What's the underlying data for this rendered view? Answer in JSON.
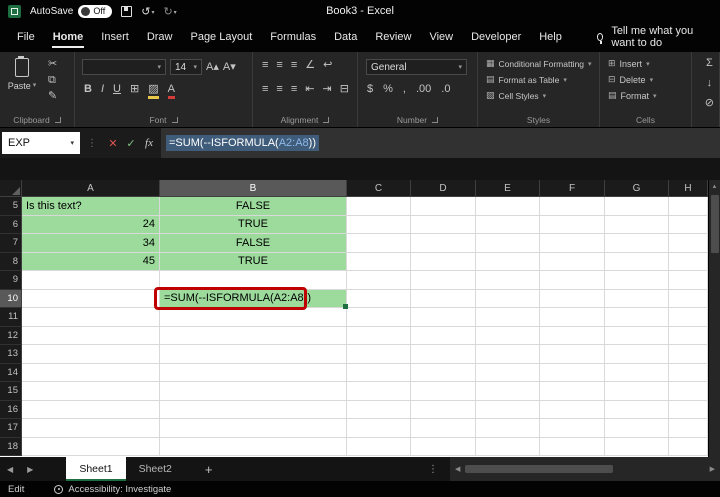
{
  "title_bar": {
    "autosave_label": "AutoSave",
    "autosave_state": "Off",
    "workbook_title": "Book3 - Excel"
  },
  "menu_bar": {
    "tabs": [
      "File",
      "Home",
      "Insert",
      "Draw",
      "Page Layout",
      "Formulas",
      "Data",
      "Review",
      "View",
      "Developer",
      "Help"
    ],
    "active_tab": "Home",
    "tell_me": "Tell me what you want to do"
  },
  "ribbon": {
    "clipboard": {
      "label": "Clipboard",
      "paste": "Paste"
    },
    "font": {
      "label": "Font",
      "size": "14",
      "bold": "B",
      "italic": "I",
      "underline": "U"
    },
    "alignment": {
      "label": "Alignment"
    },
    "number": {
      "label": "Number",
      "format": "General"
    },
    "styles": {
      "label": "Styles",
      "items": [
        "Conditional Formatting",
        "Format as Table",
        "Cell Styles"
      ]
    },
    "cells": {
      "label": "Cells",
      "items": [
        "Insert",
        "Delete",
        "Format"
      ]
    }
  },
  "formula_bar": {
    "name_box": "EXP",
    "formula_prefix": "=SUM(--ISFORMULA(",
    "formula_ref": "A2:A8",
    "formula_suffix": "))"
  },
  "grid": {
    "columns": [
      "A",
      "B",
      "C",
      "D",
      "E",
      "F",
      "G",
      "H"
    ],
    "row_numbers": [
      "5",
      "6",
      "7",
      "8",
      "9",
      "10",
      "11",
      "12",
      "13",
      "14",
      "15",
      "16",
      "17",
      "18"
    ],
    "active_column": "B",
    "active_row": "10",
    "cells": [
      {
        "ref": "A5",
        "value": "Is this text?",
        "align": "left",
        "fill": true
      },
      {
        "ref": "A6",
        "value": "24",
        "align": "right",
        "fill": true
      },
      {
        "ref": "A7",
        "value": "34",
        "align": "right",
        "fill": true
      },
      {
        "ref": "A8",
        "value": "45",
        "align": "right",
        "fill": true
      },
      {
        "ref": "B5",
        "value": "FALSE",
        "align": "center",
        "fill": true
      },
      {
        "ref": "B6",
        "value": "TRUE",
        "align": "center",
        "fill": true
      },
      {
        "ref": "B7",
        "value": "FALSE",
        "align": "center",
        "fill": true
      },
      {
        "ref": "B8",
        "value": "TRUE",
        "align": "center",
        "fill": true
      },
      {
        "ref": "B10",
        "value": "=SUM(--ISFORMULA(A2:A8))",
        "align": "left",
        "fill": true,
        "annotated": true,
        "active": true
      }
    ],
    "colors": {
      "fill_green": "#9CDB9C",
      "annotation_red": "#C00000"
    }
  },
  "sheet_bar": {
    "tabs": [
      "Sheet1",
      "Sheet2"
    ],
    "active_tab": "Sheet1"
  },
  "status_bar": {
    "mode": "Edit",
    "accessibility": "Accessibility: Investigate"
  },
  "icons": {
    "chevron": "▾",
    "scissors": "✂",
    "copy": "⧉",
    "format_painter": "✎",
    "borders": "⊞",
    "fill_color": "▨",
    "font_color": "A",
    "grow_font": "A▴",
    "shrink_font": "A▾",
    "align": "≡",
    "orientation": "∠",
    "wrap": "↩",
    "merge": "⊟",
    "indent_left": "⇤",
    "indent_right": "⇥",
    "dollar": "$",
    "percent": "%",
    "comma": ",",
    "increase_decimal": ".00",
    "decrease_decimal": ".0",
    "sum": "Σ",
    "fill": "↓",
    "clear": "⊘",
    "cancel": "✕",
    "check": "✓",
    "fx": "fx",
    "dots": "⋮",
    "ellipsis": "…",
    "left_arrow": "◀",
    "right_arrow": "▶",
    "up_arrow": "▲",
    "undo": "↺",
    "redo": "↻",
    "plus": "+",
    "style_item_icons": [
      "▦",
      "▤",
      "▧"
    ],
    "cell_item_icons": [
      "⊞",
      "⊟",
      "▤"
    ]
  }
}
